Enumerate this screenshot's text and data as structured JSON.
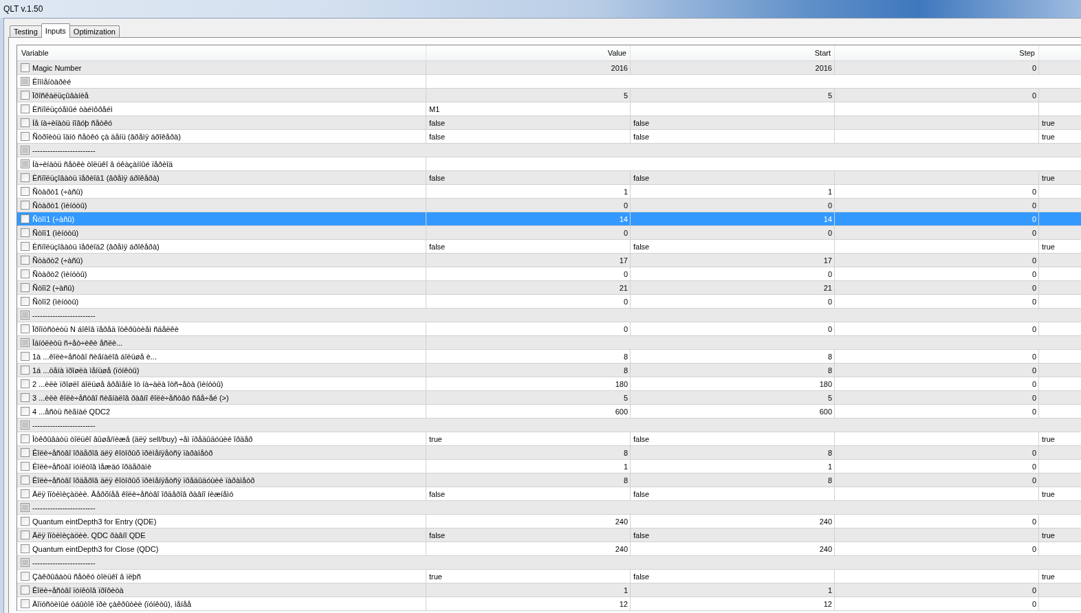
{
  "window": {
    "title": "QLT v.1.50"
  },
  "tabs": [
    {
      "label": "Testing",
      "selected": false
    },
    {
      "label": "Inputs",
      "selected": true
    },
    {
      "label": "Optimization",
      "selected": false
    }
  ],
  "table": {
    "columns": [
      "Variable",
      "Value",
      "Start",
      "Step"
    ],
    "rows": [
      {
        "kind": "number",
        "checked": false,
        "disabled": false,
        "selected": false,
        "variable": "Magic Number",
        "value": "2016",
        "start": "2016",
        "step": "0"
      },
      {
        "kind": "note",
        "checked": false,
        "disabled": true,
        "selected": false,
        "variable": "Êîììåíòàðèé"
      },
      {
        "kind": "number",
        "checked": false,
        "disabled": false,
        "selected": false,
        "variable": "Ïðîñêàëüçûâàíèå",
        "value": "5",
        "start": "5",
        "step": "0"
      },
      {
        "kind": "text",
        "checked": false,
        "disabled": false,
        "selected": false,
        "variable": "Èñïîëüçóåìûé òàéìôðåéì",
        "value": "M1"
      },
      {
        "kind": "bool",
        "checked": false,
        "disabled": false,
        "selected": false,
        "variable": "Íå íà÷èíàòü íîâóþ ñåòêó",
        "value": "false",
        "start": "false",
        "column_5": "true"
      },
      {
        "kind": "bool",
        "checked": false,
        "disabled": false,
        "selected": false,
        "variable": "Ñòðîèòü îäíó ñåòêó çà äåíü (âðåìÿ áðîêåðà)",
        "value": "false",
        "start": "false",
        "column_5": "true"
      },
      {
        "kind": "separator",
        "checked": false,
        "disabled": true,
        "selected": false,
        "variable": "-------------------------"
      },
      {
        "kind": "note",
        "checked": false,
        "disabled": true,
        "selected": false,
        "variable": "Íà÷èíàòü ñåòêè òîëüêî â óêàçàííûé ïåðèîä"
      },
      {
        "kind": "bool",
        "checked": false,
        "disabled": false,
        "selected": false,
        "variable": "Èñïîëüçîâàòü ïåðèîä1 (âðåìÿ áðîêåðà)",
        "value": "false",
        "start": "false",
        "column_5": "true"
      },
      {
        "kind": "number",
        "checked": false,
        "disabled": false,
        "selected": false,
        "variable": "Ñòàðò1 (÷àñû)",
        "value": "1",
        "start": "1",
        "step": "0"
      },
      {
        "kind": "number",
        "checked": false,
        "disabled": false,
        "selected": false,
        "variable": "Ñòàðò1 (ìèíóòû)",
        "value": "0",
        "start": "0",
        "step": "0"
      },
      {
        "kind": "number",
        "checked": false,
        "disabled": false,
        "selected": true,
        "variable": "Ñòîï1 (÷àñû)",
        "value": "14",
        "start": "14",
        "step": "0"
      },
      {
        "kind": "number",
        "checked": false,
        "disabled": false,
        "selected": false,
        "variable": "Ñòîï1 (ìèíóòû)",
        "value": "0",
        "start": "0",
        "step": "0"
      },
      {
        "kind": "bool",
        "checked": false,
        "disabled": false,
        "selected": false,
        "variable": "Èñïîëüçîâàòü ïåðèîä2 (âðåìÿ áðîêåðà)",
        "value": "false",
        "start": "false",
        "column_5": "true"
      },
      {
        "kind": "number",
        "checked": false,
        "disabled": false,
        "selected": false,
        "variable": "Ñòàðò2 (÷àñû)",
        "value": "17",
        "start": "17",
        "step": "0"
      },
      {
        "kind": "number",
        "checked": false,
        "disabled": false,
        "selected": false,
        "variable": "Ñòàðò2 (ìèíóòû)",
        "value": "0",
        "start": "0",
        "step": "0"
      },
      {
        "kind": "number",
        "checked": false,
        "disabled": false,
        "selected": false,
        "variable": "Ñòîï2 (÷àñû)",
        "value": "21",
        "start": "21",
        "step": "0"
      },
      {
        "kind": "number",
        "checked": false,
        "disabled": false,
        "selected": false,
        "variable": "Ñòîï2 (ìèíóòû)",
        "value": "0",
        "start": "0",
        "step": "0"
      },
      {
        "kind": "separator",
        "checked": false,
        "disabled": true,
        "selected": false,
        "variable": "-------------------------"
      },
      {
        "kind": "number",
        "checked": false,
        "disabled": false,
        "selected": false,
        "variable": "Ïðîïóñòèòü N áîêîâ ïåðåä îòêðûòèåì ñäåëêè",
        "value": "0",
        "start": "0",
        "step": "0"
      },
      {
        "kind": "note",
        "checked": false,
        "disabled": true,
        "selected": false,
        "variable": "Îáíóëèòü ñ÷åò÷èêè åñëè..."
      },
      {
        "kind": "number",
        "checked": false,
        "disabled": false,
        "selected": false,
        "variable": "1à ...êîëè÷åñòâî ñèãíàëîâ áîëüøå è...",
        "value": "8",
        "start": "8",
        "step": "0"
      },
      {
        "kind": "number",
        "checked": false,
        "disabled": false,
        "selected": false,
        "variable": "1á ...öåíà ïðîøëà ìåíüøå (ïóíêòû)",
        "value": "8",
        "start": "8",
        "step": "0"
      },
      {
        "kind": "number",
        "checked": false,
        "disabled": false,
        "selected": false,
        "variable": "2 ...èëè ïðîøëî áîëüøå âðåìåíè îò íà÷àëà îòñ÷åòà (ìèíóòû)",
        "value": "180",
        "start": "180",
        "step": "0"
      },
      {
        "kind": "number",
        "checked": false,
        "disabled": false,
        "selected": false,
        "variable": "3 ...èëè êîëè÷åñòâî ñèãíàëîâ ðàâíî êîëè÷åñòâó ñâå÷åé (>)",
        "value": "5",
        "start": "5",
        "step": "0"
      },
      {
        "kind": "number",
        "checked": false,
        "disabled": false,
        "selected": false,
        "variable": "4 ...åñòü ñèãíàë QDC2",
        "value": "600",
        "start": "600",
        "step": "0"
      },
      {
        "kind": "separator",
        "checked": false,
        "disabled": true,
        "selected": false,
        "variable": "-------------------------"
      },
      {
        "kind": "bool",
        "checked": false,
        "disabled": false,
        "selected": false,
        "variable": "Îòêðûâàòü òîëüêî âûøå/íèæå (äëÿ sell/buy) ÷åì ïðåäûäóùèé îðäåð",
        "value": "true",
        "start": "false",
        "column_5": "true"
      },
      {
        "kind": "number",
        "checked": false,
        "disabled": false,
        "selected": false,
        "variable": "Êîëè÷åñòâî îðäåðîâ äëÿ êîòîðûõ ïðèìåíÿåòñÿ ïàðàìåòð",
        "value": "8",
        "start": "8",
        "step": "0"
      },
      {
        "kind": "number",
        "checked": false,
        "disabled": false,
        "selected": false,
        "variable": "Êîëè÷åñòâî ïóíêòîâ ìåæäó îðäåðàìè",
        "value": "1",
        "start": "1",
        "step": "0"
      },
      {
        "kind": "number",
        "checked": false,
        "disabled": false,
        "selected": false,
        "variable": "Êîëè÷åñòâî îðäåðîâ äëÿ êîòîðûõ ïðèìåíÿåòñÿ ïðåäûäóùèé ïàðàìåòð",
        "value": "8",
        "start": "8",
        "step": "0"
      },
      {
        "kind": "bool",
        "checked": false,
        "disabled": false,
        "selected": false,
        "variable": "Äëÿ îïòèìèçàöèè. Âåðõíåå êîëè÷åñòâî îðäåðîâ ðàâíî íèæíåìó",
        "value": "false",
        "start": "false",
        "column_5": "true"
      },
      {
        "kind": "separator",
        "checked": false,
        "disabled": true,
        "selected": false,
        "variable": "-------------------------"
      },
      {
        "kind": "number",
        "checked": false,
        "disabled": false,
        "selected": false,
        "variable": "Quantum eintDepth3 for Entry (QDE)",
        "value": "240",
        "start": "240",
        "step": "0"
      },
      {
        "kind": "bool",
        "checked": false,
        "disabled": false,
        "selected": false,
        "variable": "Äëÿ îïòèìèçàöèè. QDC ðàâíî QDE",
        "value": "false",
        "start": "false",
        "column_5": "true"
      },
      {
        "kind": "number",
        "checked": false,
        "disabled": false,
        "selected": false,
        "variable": "Quantum eintDepth3 for Close (QDC)",
        "value": "240",
        "start": "240",
        "step": "0"
      },
      {
        "kind": "separator",
        "checked": false,
        "disabled": true,
        "selected": false,
        "variable": "-------------------------"
      },
      {
        "kind": "bool",
        "checked": false,
        "disabled": false,
        "selected": false,
        "variable": "Çàêðûâàòü ñåòêó òîëüêî â ïëþñ",
        "value": "true",
        "start": "false",
        "column_5": "true"
      },
      {
        "kind": "number",
        "checked": false,
        "disabled": false,
        "selected": false,
        "variable": "Êîëè÷åñòâî ïóíêòîâ ïðîôèòà",
        "value": "1",
        "start": "1",
        "step": "0"
      },
      {
        "kind": "number",
        "checked": false,
        "disabled": false,
        "selected": false,
        "variable": "Äîïóñòèìûé óáûòîê ïðè çàêðûòèè (ïóíêòû), ìåíåå",
        "value": "12",
        "start": "12",
        "step": "0"
      }
    ]
  }
}
